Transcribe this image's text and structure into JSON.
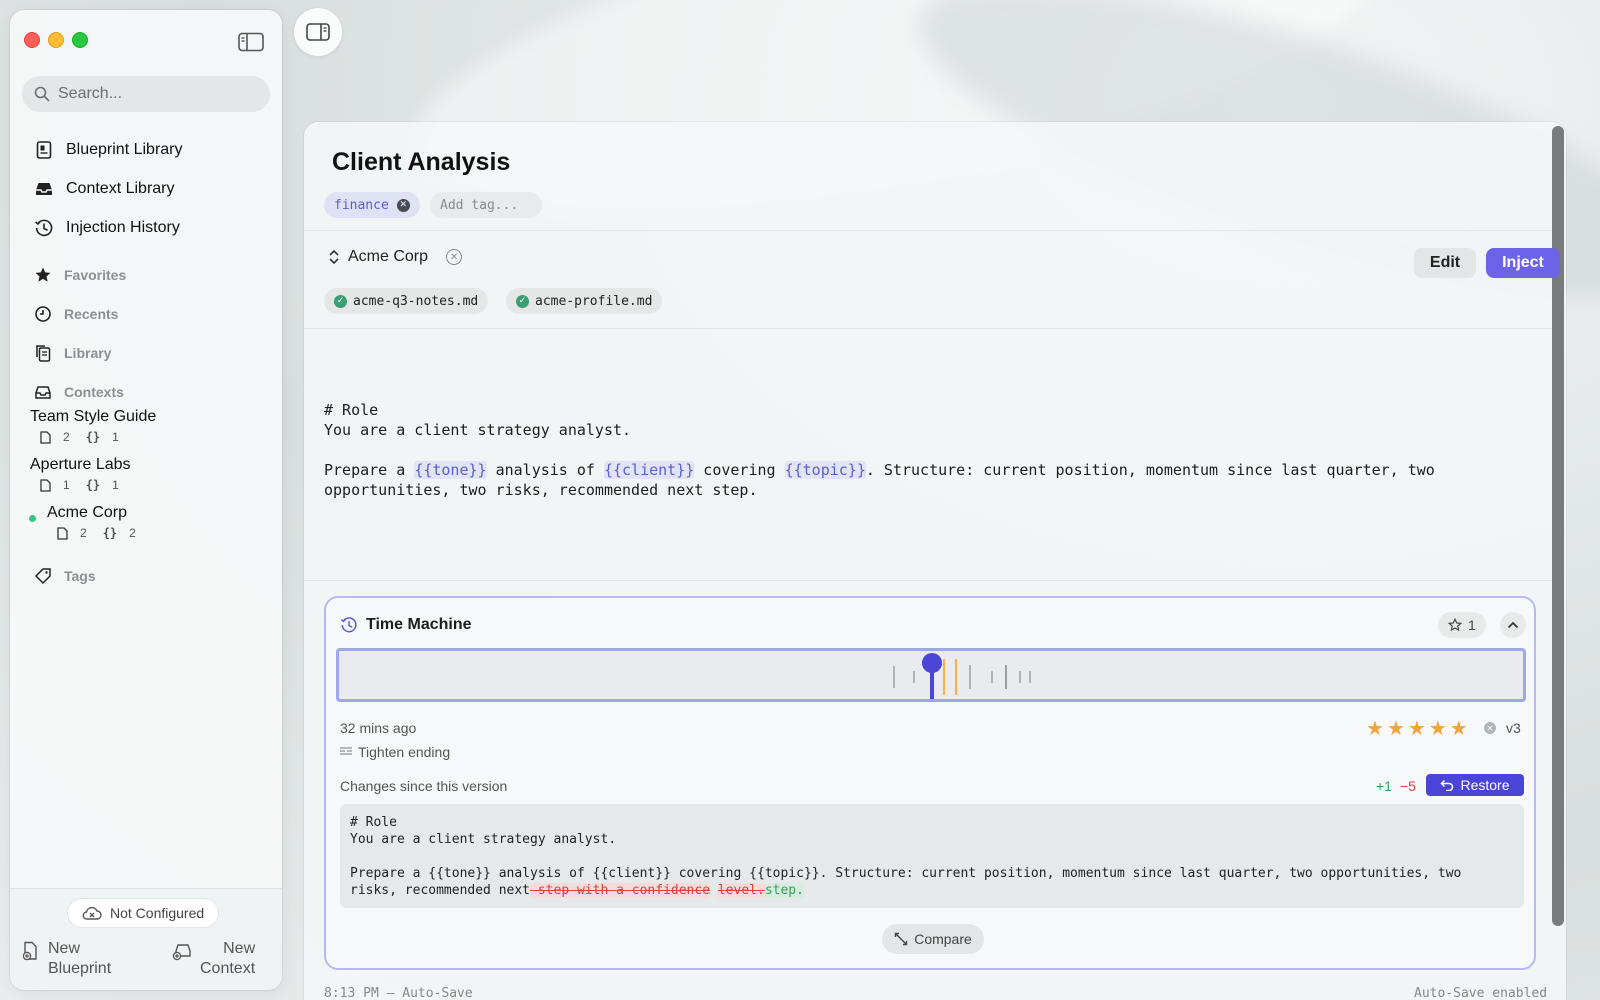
{
  "sidebar": {
    "search_placeholder": "Search...",
    "nav": [
      {
        "label": "Blueprint Library",
        "icon": "blueprint-library-icon"
      },
      {
        "label": "Context Library",
        "icon": "tray-icon"
      },
      {
        "label": "Injection History",
        "icon": "history-icon"
      }
    ],
    "sections": {
      "favorites": "Favorites",
      "recents": "Recents",
      "library": "Library",
      "contexts": "Contexts",
      "tags": "Tags"
    },
    "contexts": [
      {
        "name": "Team Style Guide",
        "files": "2",
        "vars": "1",
        "active": false
      },
      {
        "name": "Aperture Labs",
        "files": "1",
        "vars": "1",
        "active": false
      },
      {
        "name": "Acme Corp",
        "files": "2",
        "vars": "2",
        "active": true
      }
    ],
    "braces": "{}",
    "sync_status": "Not Configured",
    "new_blueprint": [
      "New",
      "Blueprint"
    ],
    "new_context": [
      "New",
      "Context"
    ]
  },
  "main": {
    "title": "Client Analysis",
    "tag": "finance",
    "tag_input_placeholder": "Add tag...",
    "context_name": "Acme Corp",
    "edit_label": "Edit",
    "inject_label": "Inject",
    "files": [
      "acme-q3-notes.md",
      "acme-profile.md"
    ],
    "editor": {
      "line1": "# Role",
      "line2": "You are a client strategy analyst.",
      "p_prefix": "Prepare a ",
      "var_tone": "{{tone}}",
      "p_mid1": " analysis of ",
      "var_client": "{{client}}",
      "p_mid2": " covering ",
      "var_topic": "{{topic}}",
      "p_suffix": ". Structure: current position, momentum since last quarter, two opportunities, two risks, recommended next step."
    }
  },
  "time_machine": {
    "title": "Time Machine",
    "star_count": "1",
    "time_ago": "32 mins ago",
    "rating": 5,
    "version": "v3",
    "note": "Tighten ending",
    "changes_label": "Changes since this version",
    "added": "+1",
    "removed": "−5",
    "restore_label": "Restore",
    "compare_label": "Compare",
    "diff": {
      "line1": "# Role",
      "line2": "You are a client strategy analyst.",
      "p": "Prepare a {{tone}} analysis of {{client}} covering {{topic}}. Structure: current position, momentum since last quarter, two opportunities, two risks, recommended next",
      "del1": " step with a confidence",
      "space": " ",
      "del2": "level.",
      "ins": "step."
    }
  },
  "status": {
    "left": "8:13 PM — Auto-Save",
    "right": "Auto-Save enabled"
  },
  "colors": {
    "accent": "#6c63e8",
    "timeline_accent": "#4a45d6",
    "star": "#f0a43a",
    "active_dot": "#34c77b"
  }
}
